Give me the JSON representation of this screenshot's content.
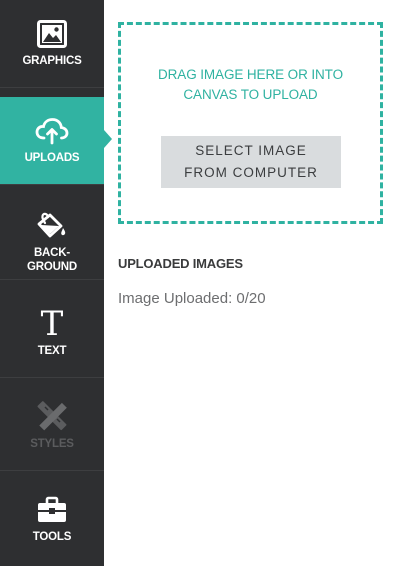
{
  "sidebar": {
    "items": [
      {
        "label": "GRAPHICS",
        "icon": "image-icon",
        "active": false,
        "enabled": true
      },
      {
        "label": "UPLOADS",
        "icon": "cloud-upload-icon",
        "active": true,
        "enabled": true
      },
      {
        "label": "BACK-\nGROUND",
        "icon": "paint-bucket-icon",
        "active": false,
        "enabled": true
      },
      {
        "label": "TEXT",
        "icon": "text-t-icon",
        "glyph": "T",
        "active": false,
        "enabled": true
      },
      {
        "label": "STYLES",
        "icon": "pencil-ruler-icon",
        "active": false,
        "enabled": false
      },
      {
        "label": "TOOLS",
        "icon": "toolbox-icon",
        "active": false,
        "enabled": true
      }
    ]
  },
  "upload": {
    "drop_text": "DRAG IMAGE HERE OR INTO\nCANVAS TO UPLOAD",
    "select_button": "SELECT IMAGE\nFROM COMPUTER",
    "section_title": "UPLOADED IMAGES",
    "count_text": "Image Uploaded: 0/20"
  },
  "colors": {
    "accent": "#31b3a2",
    "sidebar_bg": "#2e2f31",
    "disabled": "#5b5c5e",
    "button_bg": "#d9dcde"
  }
}
